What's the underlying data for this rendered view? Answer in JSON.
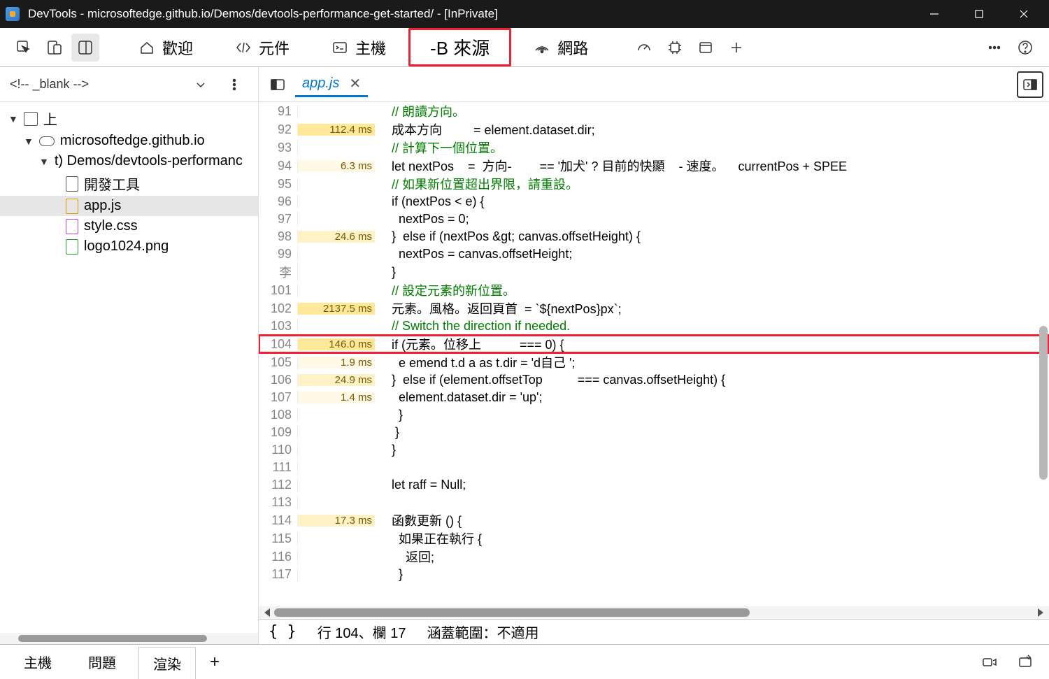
{
  "window": {
    "title": "DevTools - microsoftedge.github.io/Demos/devtools-performance-get-started/ - [InPrivate]"
  },
  "toptabs": {
    "welcome": "歡迎",
    "elements": "元件",
    "console": "主機",
    "sources": "-B 來源",
    "network": "網路"
  },
  "secondrow": {
    "selector": "<!-- _blank -->",
    "open_tab": "app.js"
  },
  "tree": {
    "root": "上",
    "domain": "microsoftedge.github.io",
    "folder": "t) Demos/devtools-performanc",
    "files": [
      "開發工具",
      "app.js",
      "style.css",
      "logo1024.png"
    ]
  },
  "code": {
    "lines": [
      {
        "n": 91,
        "ms": "",
        "txt": "// 朗讀方向。",
        "cls": "green"
      },
      {
        "n": 92,
        "ms": "112.4 ms",
        "lvl": "h",
        "txt": "成本方向         = element.dataset.dir;"
      },
      {
        "n": 93,
        "ms": "",
        "txt": "// 計算下一個位置。",
        "cls": "green"
      },
      {
        "n": 94,
        "ms": "6.3 ms",
        "lvl": "l",
        "txt": "let nextPos    =  方向-        == '加犬' ? 目前的快顯    - 速度。    currentPos + SPEE"
      },
      {
        "n": 95,
        "ms": "",
        "txt": "// 如果新位置超出界限，請重設。",
        "cls": "green"
      },
      {
        "n": 96,
        "ms": "",
        "txt": "if (nextPos < e) {"
      },
      {
        "n": 97,
        "ms": "",
        "txt": "  nextPos = 0;"
      },
      {
        "n": 98,
        "ms": "24.6 ms",
        "lvl": "m",
        "txt": "}  else if (nextPos &gt; canvas.offsetHeight) {"
      },
      {
        "n": 99,
        "ms": "",
        "txt": "  nextPos = canvas.offsetHeight;"
      },
      {
        "n": "李",
        "ms": "",
        "txt": "}"
      },
      {
        "n": 101,
        "ms": "",
        "txt": "// 設定元素的新位置。",
        "cls": "green"
      },
      {
        "n": 102,
        "ms": "2137.5 ms",
        "lvl": "h",
        "txt": "元素。風格。返回頁首  = `${nextPos}px`;"
      },
      {
        "n": 103,
        "ms": "",
        "txt": "// Switch the direction if needed.",
        "cls": "green"
      },
      {
        "n": 104,
        "ms": "146.0 ms",
        "lvl": "h",
        "txt": "if (元素。位移上           === 0) {",
        "red": true
      },
      {
        "n": 105,
        "ms": "1.9 ms",
        "lvl": "l",
        "txt": "  e emend t.d a as t.dir = 'd自己 ';"
      },
      {
        "n": 106,
        "ms": "24.9 ms",
        "lvl": "m",
        "txt": "}  else if (element.offsetTop          === canvas.offsetHeight) {"
      },
      {
        "n": 107,
        "ms": "1.4 ms",
        "lvl": "l",
        "txt": "  element.dataset.dir = 'up';"
      },
      {
        "n": 108,
        "ms": "",
        "txt": "  }"
      },
      {
        "n": 109,
        "ms": "",
        "txt": " }"
      },
      {
        "n": 110,
        "ms": "",
        "txt": "}"
      },
      {
        "n": 111,
        "ms": "",
        "txt": ""
      },
      {
        "n": 112,
        "ms": "",
        "txt": "let raff = Null;"
      },
      {
        "n": 113,
        "ms": "",
        "txt": ""
      },
      {
        "n": 114,
        "ms": "17.3 ms",
        "lvl": "m",
        "txt": "函數更新 () {"
      },
      {
        "n": 115,
        "ms": "",
        "txt": "  如果正在執行 {"
      },
      {
        "n": 116,
        "ms": "",
        "txt": "    返回;"
      },
      {
        "n": 117,
        "ms": "",
        "txt": "  }"
      }
    ]
  },
  "status": {
    "pos": "行 104、欄 17",
    "coverage": "涵蓋範圍：不適用"
  },
  "bottomtabs": {
    "console": "主機",
    "issues": "問題",
    "rendering": "渲染"
  }
}
